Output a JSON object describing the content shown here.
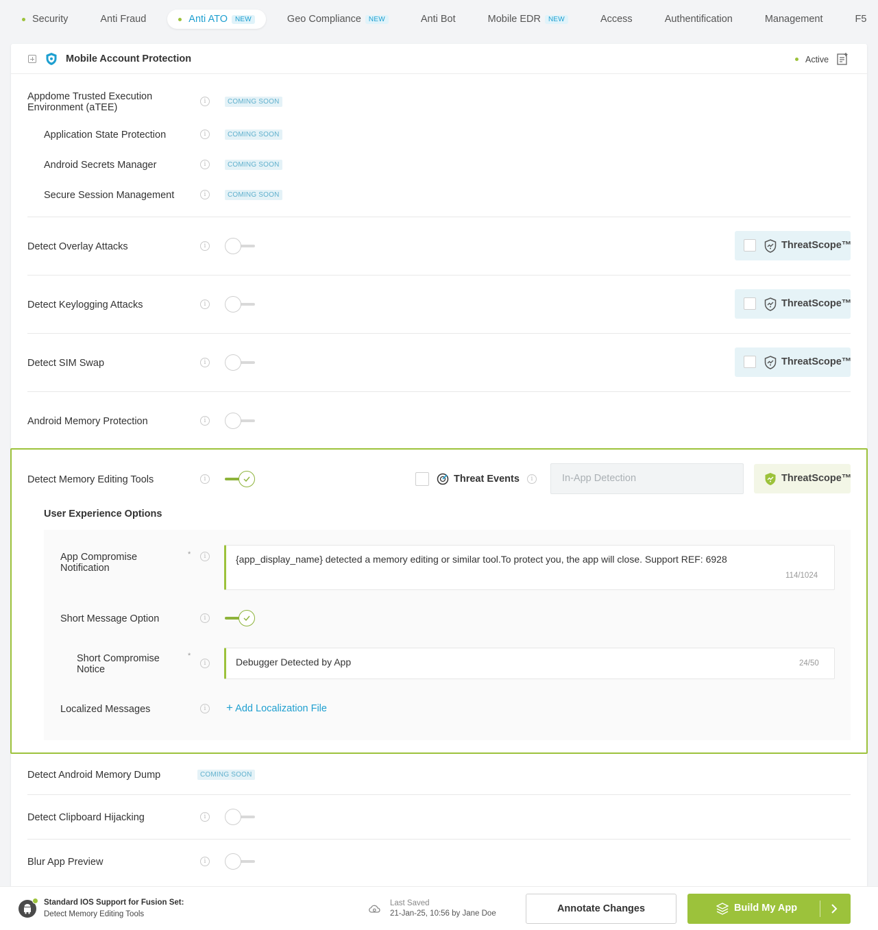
{
  "tabs": [
    {
      "label": "Security",
      "dot": true,
      "active": false,
      "badge": ""
    },
    {
      "label": "Anti Fraud",
      "dot": false,
      "active": false,
      "badge": ""
    },
    {
      "label": "Anti ATO",
      "dot": true,
      "active": true,
      "badge": "NEW"
    },
    {
      "label": "Geo Compliance",
      "dot": false,
      "active": false,
      "badge": "NEW"
    },
    {
      "label": "Anti Bot",
      "dot": false,
      "active": false,
      "badge": ""
    },
    {
      "label": "Mobile EDR",
      "dot": false,
      "active": false,
      "badge": "NEW"
    },
    {
      "label": "Access",
      "dot": false,
      "active": false,
      "badge": ""
    },
    {
      "label": "Authentification",
      "dot": false,
      "active": false,
      "badge": ""
    },
    {
      "label": "Management",
      "dot": false,
      "active": false,
      "badge": ""
    },
    {
      "label": "F5",
      "dot": false,
      "active": false,
      "badge": ""
    }
  ],
  "card": {
    "title": "Mobile Account Protection",
    "status": "Active",
    "icons": {
      "expand": "expand-plus-icon",
      "shield": "shield-icon",
      "notes": "notes-icon"
    }
  },
  "coming_soon_label": "COMING SOON",
  "atee": {
    "title": "Appdome Trusted Execution Environment (aTEE)",
    "children": [
      "Application State Protection",
      "Android Secrets Manager",
      "Secure Session Management"
    ]
  },
  "features": {
    "overlay": {
      "label": "Detect Overlay Attacks",
      "enabled": false
    },
    "keylogging": {
      "label": "Detect Keylogging Attacks",
      "enabled": false
    },
    "simswap": {
      "label": "Detect SIM Swap",
      "enabled": false
    },
    "memory_protection": {
      "label": "Android Memory Protection",
      "enabled": false
    },
    "memory_dump": {
      "label": "Detect Android Memory Dump"
    },
    "clipboard": {
      "label": "Detect Clipboard Hijacking",
      "enabled": false
    },
    "blur": {
      "label": "Blur App Preview",
      "enabled": false
    }
  },
  "threatscope_label": "ThreatScope™",
  "active_feature": {
    "label": "Detect Memory Editing Tools",
    "enabled": true,
    "threat_events_label": "Threat Events",
    "in_app_placeholder": "In-App Detection",
    "ux_title": "User Experience Options",
    "notification": {
      "label": "App Compromise Notification",
      "value": "{app_display_name} detected a memory editing or similar tool.To protect you, the app will close. Support REF: 6928",
      "counter": "114/1024"
    },
    "short_message": {
      "label": "Short Message Option",
      "enabled": true
    },
    "short_notice": {
      "label": "Short Compromise Notice",
      "value": "Debugger Detected by App",
      "counter": "24/50"
    },
    "localized": {
      "label": "Localized Messages",
      "link": "Add Localization File"
    }
  },
  "footer": {
    "title": "Standard IOS Support for Fusion Set:",
    "subtitle": "Detect Memory Editing Tools",
    "saved_label": "Last Saved",
    "saved_value": "21-Jan-25, 10:56 by Jane Doe",
    "annotate_label": "Annotate Changes",
    "build_label": "Build My App"
  },
  "colors": {
    "accent_green": "#9cc23b",
    "accent_blue": "#1e9fd0"
  }
}
